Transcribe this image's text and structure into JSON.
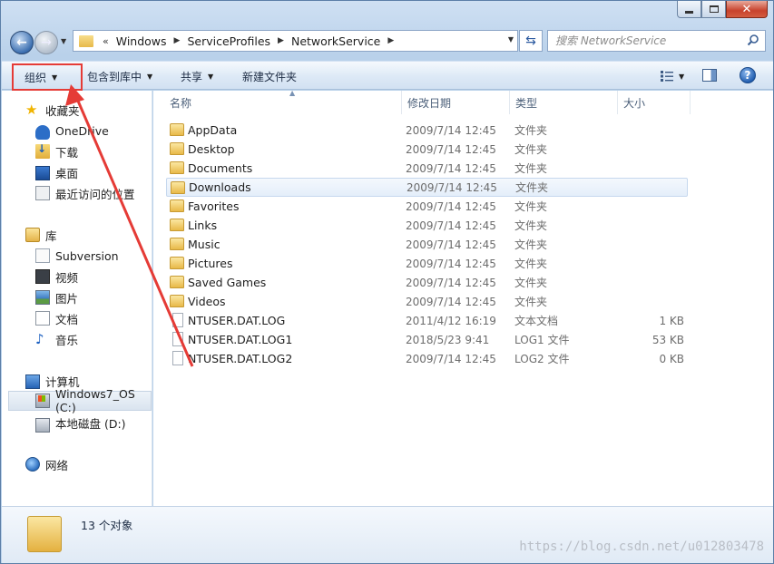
{
  "address": {
    "overflow": "«",
    "crumbs": [
      "Windows",
      "ServiceProfiles",
      "NetworkService"
    ]
  },
  "search": {
    "placeholder": "搜索 NetworkService"
  },
  "toolbar": {
    "organize": "组织",
    "include": "包含到库中",
    "share": "共享",
    "new_folder": "新建文件夹"
  },
  "nav": {
    "favorites": "收藏夹",
    "onedrive": "OneDrive",
    "downloads": "下载",
    "desktop": "桌面",
    "recent": "最近访问的位置",
    "libraries": "库",
    "subversion": "Subversion",
    "videos": "视频",
    "pictures": "图片",
    "documents": "文档",
    "music": "音乐",
    "computer": "计算机",
    "drive_c": "Windows7_OS (C:)",
    "drive_d": "本地磁盘 (D:)",
    "network": "网络"
  },
  "columns": {
    "name": "名称",
    "date": "修改日期",
    "type": "类型",
    "size": "大小"
  },
  "files": [
    {
      "name": "AppData",
      "date": "2009/7/14 12:45",
      "type": "文件夹",
      "size": "",
      "kind": "folder"
    },
    {
      "name": "Desktop",
      "date": "2009/7/14 12:45",
      "type": "文件夹",
      "size": "",
      "kind": "folder"
    },
    {
      "name": "Documents",
      "date": "2009/7/14 12:45",
      "type": "文件夹",
      "size": "",
      "kind": "folder"
    },
    {
      "name": "Downloads",
      "date": "2009/7/14 12:45",
      "type": "文件夹",
      "size": "",
      "kind": "folder"
    },
    {
      "name": "Favorites",
      "date": "2009/7/14 12:45",
      "type": "文件夹",
      "size": "",
      "kind": "folder"
    },
    {
      "name": "Links",
      "date": "2009/7/14 12:45",
      "type": "文件夹",
      "size": "",
      "kind": "folder"
    },
    {
      "name": "Music",
      "date": "2009/7/14 12:45",
      "type": "文件夹",
      "size": "",
      "kind": "folder"
    },
    {
      "name": "Pictures",
      "date": "2009/7/14 12:45",
      "type": "文件夹",
      "size": "",
      "kind": "folder"
    },
    {
      "name": "Saved Games",
      "date": "2009/7/14 12:45",
      "type": "文件夹",
      "size": "",
      "kind": "folder"
    },
    {
      "name": "Videos",
      "date": "2009/7/14 12:45",
      "type": "文件夹",
      "size": "",
      "kind": "folder"
    },
    {
      "name": "NTUSER.DAT.LOG",
      "date": "2011/4/12 16:19",
      "type": "文本文档",
      "size": "1 KB",
      "kind": "file"
    },
    {
      "name": "NTUSER.DAT.LOG1",
      "date": "2018/5/23 9:41",
      "type": "LOG1 文件",
      "size": "53 KB",
      "kind": "file"
    },
    {
      "name": "NTUSER.DAT.LOG2",
      "date": "2009/7/14 12:45",
      "type": "LOG2 文件",
      "size": "0 KB",
      "kind": "file"
    }
  ],
  "status": {
    "count": "13 个对象"
  },
  "watermark": "https://blog.csdn.net/u012803478",
  "colors": {
    "annotation_red": "#e53b36",
    "selection": "#e4eefa"
  }
}
